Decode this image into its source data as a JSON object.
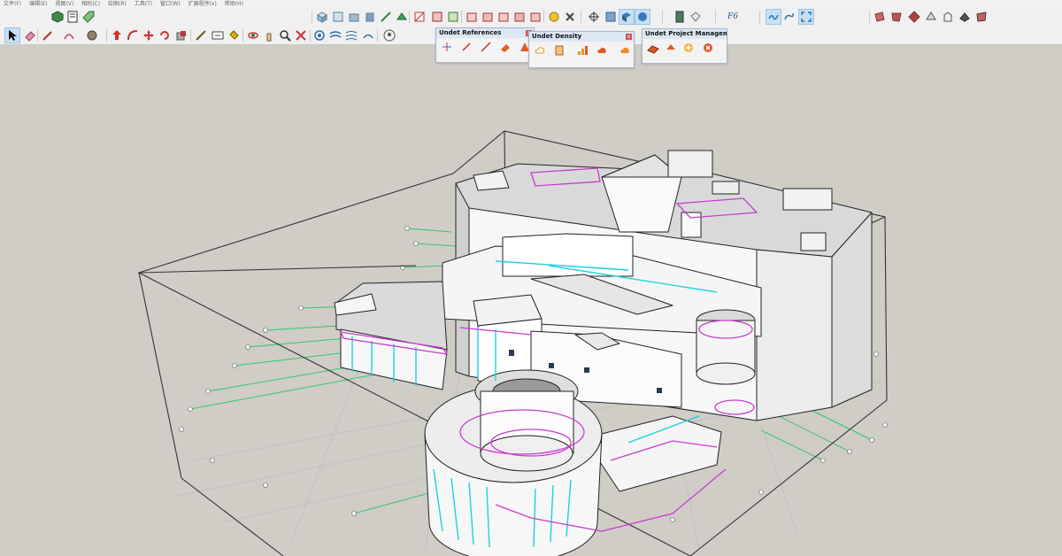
{
  "menu": [
    "文件(F)",
    "编辑(E)",
    "视图(V)",
    "相机(C)",
    "绘图(R)",
    "工具(T)",
    "窗口(W)",
    "扩展程序(x)",
    "帮助(H)"
  ],
  "toolbar_top": {
    "style_label": "F6",
    "icons": [
      "component-icon",
      "report-icon",
      "tag-icon",
      "iso-view-icon",
      "top-view-icon",
      "front-view-icon",
      "right-view-icon",
      "back-view-icon",
      "left-view-icon",
      "section-icon",
      "measure-icon",
      "texture-icon",
      "paint-icon",
      "axis-icon",
      "xray-icon",
      "shade-icon",
      "monochrome-icon",
      "layer-icon",
      "eraser-icon",
      "sandbox-icon",
      "match-photo-icon",
      "fullscreen-icon"
    ]
  },
  "toolbar_main": {
    "icons": [
      "select-arrow-icon",
      "eraser-icon",
      "pencil-icon",
      "arc-icon",
      "sphere-icon",
      "push-pull-icon",
      "follow-me-icon",
      "move-icon",
      "rotate-icon",
      "scale-icon",
      "offset-icon",
      "tape-measure-icon",
      "text-icon",
      "paint-bucket-icon",
      "orbit-icon",
      "pan-icon",
      "zoom-icon",
      "zoom-extents-icon",
      "section-plane-icon",
      "layers-icon",
      "fog-icon",
      "shadows-icon",
      "user-icon"
    ]
  },
  "panels": {
    "references": {
      "title": "Undet References",
      "close": "x"
    },
    "density": {
      "title": "Undet Density",
      "close": "x"
    },
    "project": {
      "title": "Undet Project Management"
    }
  }
}
